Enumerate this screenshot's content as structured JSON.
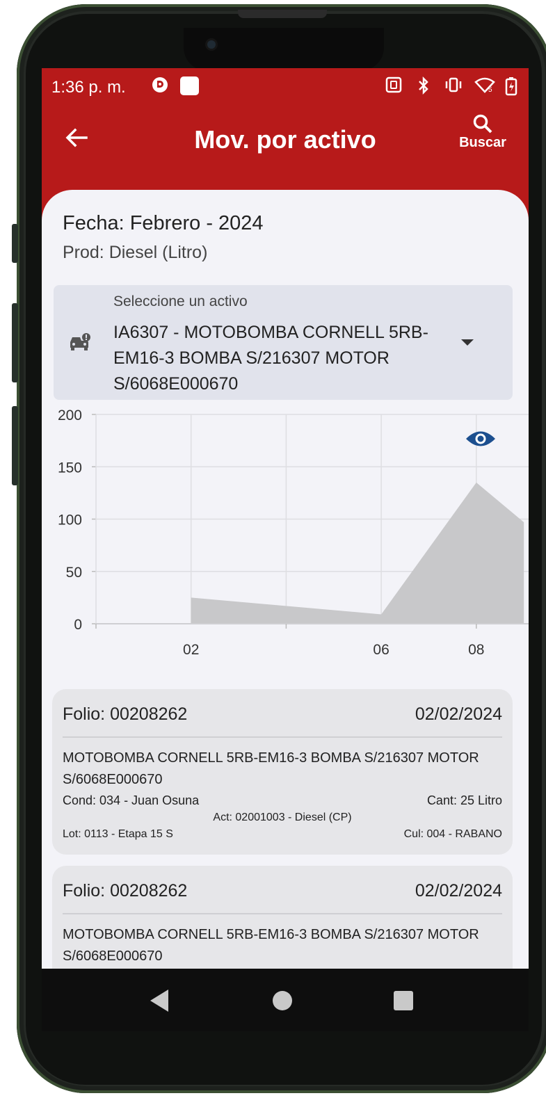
{
  "status_bar": {
    "time": "1:36 p. m.",
    "icons": [
      "notification-icon",
      "app-icon",
      "nfc-icon",
      "bluetooth-icon",
      "vibrate-icon",
      "wifi-icon",
      "battery-icon"
    ]
  },
  "appbar": {
    "title": "Mov. por activo",
    "search_label": "Buscar"
  },
  "header": {
    "fecha": "Fecha: Febrero - 2024",
    "prod": "Prod: Diesel (Litro)"
  },
  "asset_select": {
    "label": "Seleccione un activo",
    "value": "IA6307 - MOTOBOMBA CORNELL 5RB-EM16-3 BOMBA S/216307 MOTOR S/6068E000670"
  },
  "chart_data": {
    "type": "area",
    "x_ticks": [
      "02",
      "06",
      "08"
    ],
    "x": [
      2,
      6,
      8,
      9
    ],
    "values": [
      25,
      9,
      135,
      97
    ],
    "ylim": [
      0,
      200
    ],
    "y_ticks": [
      0,
      50,
      100,
      150,
      200
    ],
    "grid": true,
    "fill_color": "#c8c8ca"
  },
  "colors": {
    "primary": "#b71a1a",
    "accent": "#1c4f8f",
    "surface": "#f3f3f8"
  },
  "movements": [
    {
      "folio": "Folio: 00208262",
      "date": "02/02/2024",
      "desc": "MOTOBOMBA CORNELL 5RB-EM16-3 BOMBA S/216307 MOTOR S/6068E000670",
      "cond": "Cond: 034 - Juan Osuna",
      "cant": "Cant: 25 Litro",
      "act": "Act: 02001003 - Diesel (CP)",
      "lot": "Lot: 0113 - Etapa 15 S",
      "cul": "Cul: 004 - RABANO"
    },
    {
      "folio": "Folio: 00208262",
      "date": "02/02/2024",
      "desc": "MOTOBOMBA CORNELL 5RB-EM16-3 BOMBA S/216307 MOTOR S/6068E000670",
      "cond": "",
      "cant": "",
      "act": "",
      "lot": "",
      "cul": ""
    }
  ]
}
